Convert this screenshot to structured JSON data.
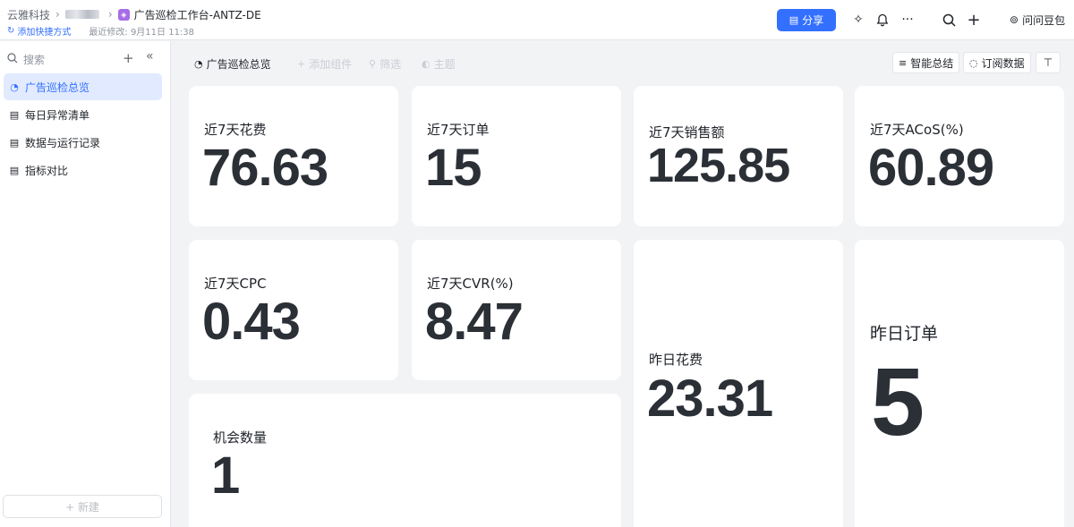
{
  "header": {
    "workspace": "云雅科技",
    "doc_title": "广告巡检工作台-ANTZ-DE",
    "add_shortcut": "添加快捷方式",
    "last_modified": "最近修改: 9月11日 11:38",
    "share_label": "分享",
    "ask_label": "问问豆包"
  },
  "sidebar": {
    "search_placeholder": "搜索",
    "items": [
      {
        "label": "广告巡检总览",
        "active": true
      },
      {
        "label": "每日异常清单",
        "active": false
      },
      {
        "label": "数据与运行记录",
        "active": false
      },
      {
        "label": "指标对比",
        "active": false
      }
    ],
    "new_label": "+ 新建"
  },
  "toolbar": {
    "page_title": "广告巡检总览",
    "add_component": "添加组件",
    "filter": "筛选",
    "theme": "主题",
    "smart_summary": "智能总结",
    "subscribe": "订阅数据"
  },
  "metrics": {
    "spend7": {
      "label": "近7天花费",
      "value": "76.63"
    },
    "orders7": {
      "label": "近7天订单",
      "value": "15"
    },
    "sales7": {
      "label": "近7天销售额",
      "value": "125.85"
    },
    "acos7": {
      "label": "近7天ACoS(%)",
      "value": "60.89"
    },
    "cpc7": {
      "label": "近7天CPC",
      "value": "0.43"
    },
    "cvr7": {
      "label": "近7天CVR(%)",
      "value": "8.47"
    },
    "opportunities": {
      "label": "机会数量",
      "value": "1"
    },
    "spend_yesterday": {
      "label": "昨日花费",
      "value": "23.31"
    },
    "orders_yesterday": {
      "label": "昨日订单",
      "value": "5"
    }
  },
  "colors": {
    "accent": "#3370ff",
    "active_bg": "#e1eaff",
    "page_bg": "#f2f3f5",
    "value_text": "#2b2f36"
  }
}
